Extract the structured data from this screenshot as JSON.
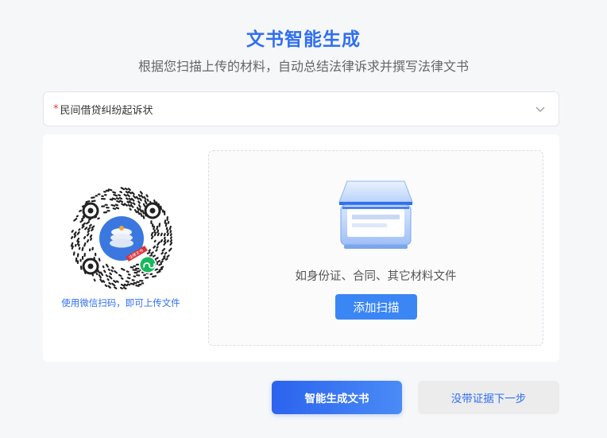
{
  "header": {
    "title": "文书智能生成",
    "subtitle": "根据您扫描上传的材料，自动总结法律诉求并撰写法律文书"
  },
  "case_type_select": {
    "required_mark": "*",
    "value": "民间借贷纠纷起诉状",
    "icon": "chevron-down-icon"
  },
  "qr": {
    "caption": "使用微信扫码，即可上传文件",
    "badge_text": "法律文书",
    "icon": "wechat-mini-program-icon"
  },
  "upload": {
    "hint": "如身份证、合同、其它材料文件",
    "button_label": "添加扫描",
    "icon": "scanner-icon"
  },
  "actions": {
    "generate_label": "智能生成文书",
    "skip_label": "没带证据下一步"
  },
  "colors": {
    "accent": "#2f6ff0",
    "button_blue": "#3b86f5",
    "required": "#e33333",
    "wechat_green": "#17b85a"
  }
}
